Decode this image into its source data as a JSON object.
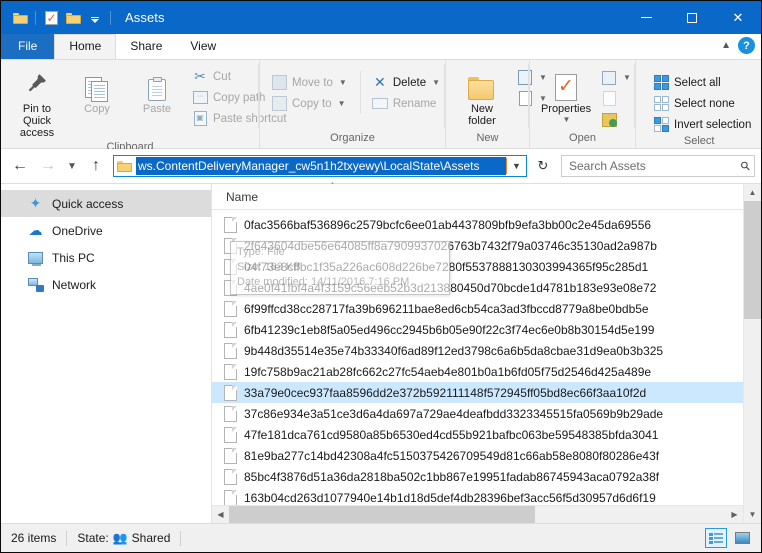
{
  "window": {
    "title": "Assets",
    "quick_access_toolbar": [
      {
        "name": "folder-properties-icon",
        "label": "Properties"
      },
      {
        "name": "new-folder-icon",
        "label": "New folder"
      },
      {
        "name": "customize-qat-icon",
        "label": "Customize Quick Access Toolbar"
      }
    ],
    "controls": {
      "minimize": "Minimize",
      "maximize": "Maximize",
      "close": "Close"
    }
  },
  "tabs": [
    {
      "label": "File",
      "active": false,
      "kind": "file"
    },
    {
      "label": "Home",
      "active": true
    },
    {
      "label": "Share",
      "active": false
    },
    {
      "label": "View",
      "active": false
    }
  ],
  "tab_right": {
    "collapse": "Minimize the Ribbon",
    "help": "?"
  },
  "ribbon": {
    "groups": [
      {
        "label": "Clipboard",
        "big": [
          {
            "label": "Pin to Quick\naccess",
            "line1": "Pin to Quick",
            "line2": "access",
            "icon": "pin-icon",
            "disabled": false
          },
          {
            "label": "Copy",
            "icon": "copy-icon",
            "disabled": true
          },
          {
            "label": "Paste",
            "icon": "paste-icon",
            "disabled": true
          }
        ],
        "small": [
          {
            "label": "Cut",
            "icon": "scissors-icon",
            "disabled": true
          },
          {
            "label": "Copy path",
            "icon": "copy-path-icon",
            "disabled": true
          },
          {
            "label": "Paste shortcut",
            "icon": "paste-shortcut-icon",
            "disabled": true
          }
        ]
      },
      {
        "label": "Organize",
        "small_left": [
          {
            "label": "Move to",
            "icon": "move-to-icon",
            "disabled": true,
            "caret": true
          },
          {
            "label": "Copy to",
            "icon": "copy-to-icon",
            "disabled": true,
            "caret": true
          }
        ],
        "small_right": [
          {
            "label": "Delete",
            "icon": "delete-icon",
            "disabled": false,
            "caret": true
          },
          {
            "label": "Rename",
            "icon": "rename-icon",
            "disabled": true
          }
        ]
      },
      {
        "label": "New",
        "big": [
          {
            "line1": "New",
            "line2": "folder",
            "icon": "new-folder-icon"
          }
        ],
        "small": [
          {
            "label": "",
            "icon": "new-item-icon",
            "caret": true
          },
          {
            "label": "",
            "icon": "easy-access-icon",
            "caret": true
          }
        ]
      },
      {
        "label": "Open",
        "big": [
          {
            "line1": "Properties",
            "line2": "",
            "icon": "properties-icon",
            "caret": true
          }
        ],
        "small": [
          {
            "label": "",
            "icon": "open-with-icon",
            "caret": true
          },
          {
            "label": "",
            "icon": "edit-icon",
            "disabled": true
          },
          {
            "label": "",
            "icon": "history-icon"
          }
        ]
      },
      {
        "label": "Select",
        "small": [
          {
            "label": "Select all",
            "icon": "select-all-icon"
          },
          {
            "label": "Select none",
            "icon": "select-none-icon"
          },
          {
            "label": "Invert selection",
            "icon": "invert-selection-icon"
          }
        ]
      }
    ]
  },
  "navbar": {
    "back": "Back",
    "forward": "Forward",
    "recent": "Recent locations",
    "up": "Up",
    "address_value": "ws.ContentDeliveryManager_cw5n1h2txyewy\\LocalState\\Assets",
    "address_dropdown": "Previous locations",
    "refresh": "Refresh",
    "search_placeholder": "Search Assets",
    "search_value": ""
  },
  "sidebar": {
    "items": [
      {
        "label": "Quick access",
        "icon": "star-icon",
        "selected": true
      },
      {
        "label": "OneDrive",
        "icon": "cloud-icon",
        "selected": false
      },
      {
        "label": "This PC",
        "icon": "computer-icon",
        "selected": false
      },
      {
        "label": "Network",
        "icon": "network-icon",
        "selected": false
      }
    ]
  },
  "file_list": {
    "column_header": "Name",
    "rows": [
      {
        "name": "0fac3566baf536896c2579bcfc6ee01ab4437809bfb9efa3bb00c2e45da69556",
        "selected": false
      },
      {
        "name": "2f643604dbe56e64085ff8a7909937026763b7432f79a03746c35130ad2a987b",
        "selected": false
      },
      {
        "name": "04f73e8cffbc1f35a226ac608d226be7280f5537888130303994365f95c285d1",
        "selected": false
      },
      {
        "name": "4ae0f41fbf4a4f3159c56eeb52b3d213880450d70bcde1d4781b183e93e08e72",
        "selected": false
      },
      {
        "name": "6f99ffcd38cc28717fa39b696211bae8ed6cb54ca3ad3fbccd8779a8be0bdb5e",
        "selected": false
      },
      {
        "name": "6fb41239c1eb8f5a05ed496cc2945b6b05e90f22c3f74ec6e0b8b30154d5e199",
        "selected": false
      },
      {
        "name": "9b448d35514e35e74b33340f6ad89f12ed3798c6a6b5da8cbae31d9ea0b3b325",
        "selected": false
      },
      {
        "name": "19fc758b9ac21ab28fc662c27fc54aeb4e801b0a1b6fd05f75d2546d425a489e",
        "selected": false
      },
      {
        "name": "33a79e0cec937faa8596dd2e372b592111148f572945ff05bd8ec66f3aa10f2d",
        "selected": true
      },
      {
        "name": "37c86e934e3a51ce3d6a4da697a729ae4deafbdd3323345515fa0569b9b29ade",
        "selected": false
      },
      {
        "name": "47fe181dca761cd9580a85b6530ed4cd55b921bafbc063be59548385bfda3041",
        "selected": false
      },
      {
        "name": "81e9ba277c14bd42308a4fc5150375426709549d81c66ab58e8080f80286e43f",
        "selected": false
      },
      {
        "name": "85bc4f3876d51a36da2818ba502c1bb867e19951fadab86745943aca0792a38f",
        "selected": false
      },
      {
        "name": "163b04cd263d1077940e14b1d18d5def4db28396bef3acc56f5d30957d6d6f19",
        "selected": false
      }
    ]
  },
  "tooltip": {
    "line1": "Type: File",
    "line2": "Size: 183 KB",
    "line3": "Date modified: 14/11/2016 7:16 PM"
  },
  "statusbar": {
    "item_count": "26 items",
    "state_label": "State:",
    "state_value": "Shared",
    "views": [
      {
        "name": "details-view-button",
        "label": "Details",
        "active": true
      },
      {
        "name": "large-icons-view-button",
        "label": "Large icons",
        "active": false
      }
    ]
  },
  "colors": {
    "title_bar": "#0a69c8",
    "accent": "#1b6ec2",
    "selection": "#cce8ff",
    "ribbon_bg": "#f3f3f3"
  }
}
